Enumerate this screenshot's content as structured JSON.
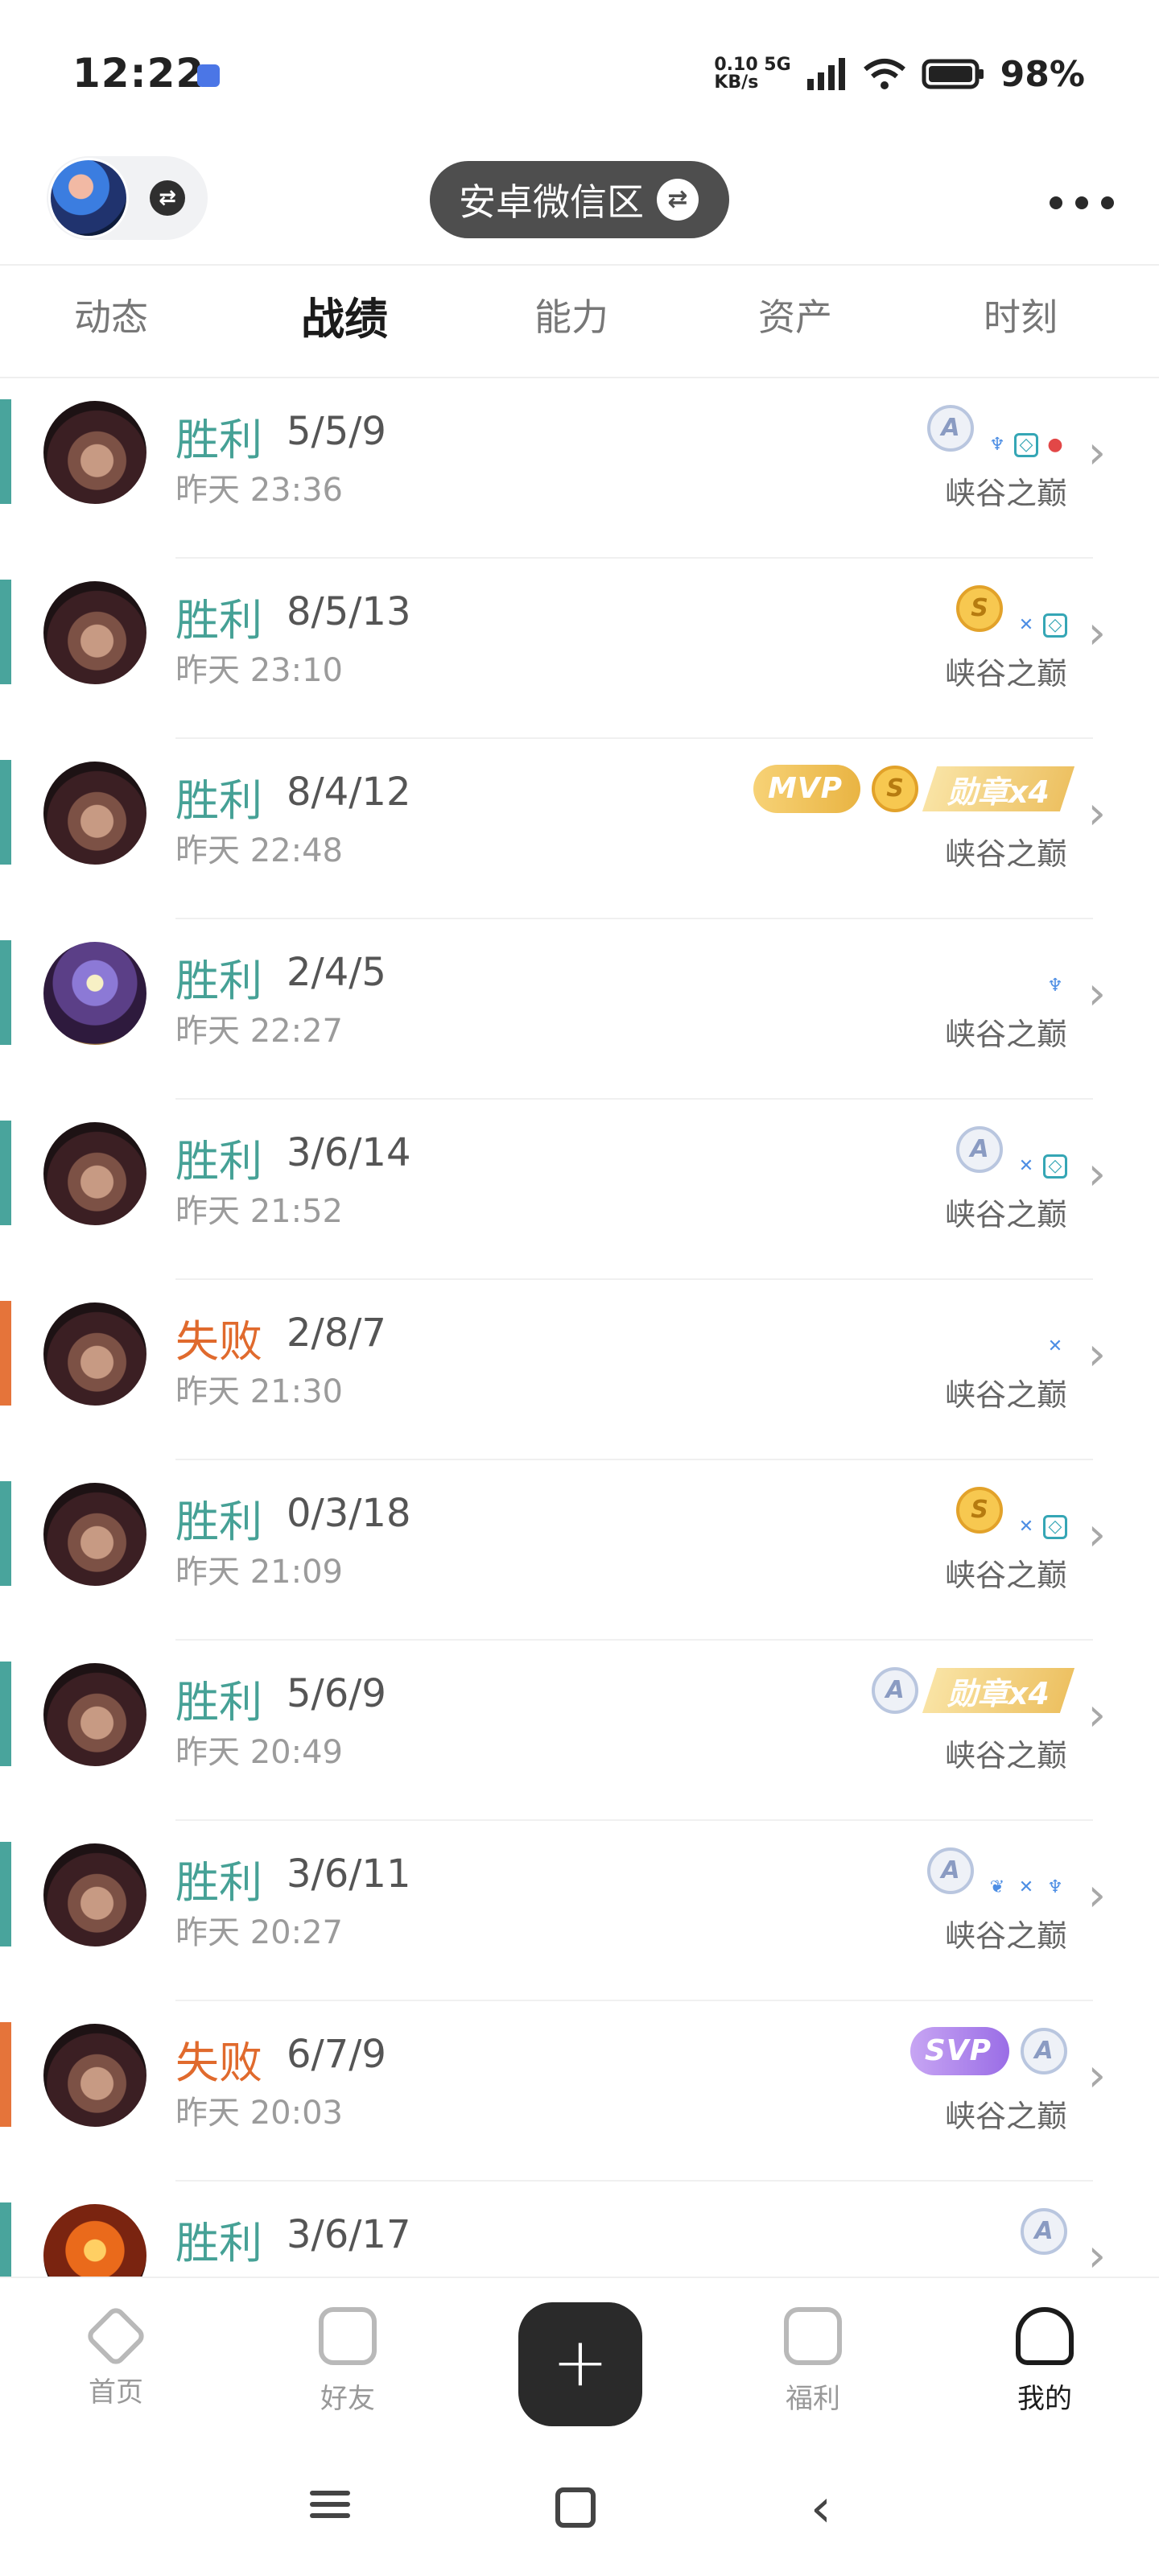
{
  "status_bar": {
    "time": "12:22",
    "net_speed_value": "0.10",
    "net_speed_unit": "KB/s",
    "network_type": "5G",
    "battery": "98%"
  },
  "header": {
    "server_name": "安卓微信区",
    "switch_symbol": "⇄"
  },
  "tabs": [
    {
      "label": "动态"
    },
    {
      "label": "战绩"
    },
    {
      "label": "能力"
    },
    {
      "label": "资产"
    },
    {
      "label": "时刻"
    }
  ],
  "matches": [
    {
      "result": "胜利",
      "kda": "5/5/9",
      "time": "昨天 23:36",
      "mode": "峡谷之巅",
      "grade": "A",
      "outcome": "win"
    },
    {
      "result": "胜利",
      "kda": "8/5/13",
      "time": "昨天 23:10",
      "mode": "峡谷之巅",
      "grade": "S",
      "outcome": "win"
    },
    {
      "result": "胜利",
      "kda": "8/4/12",
      "time": "昨天 22:48",
      "mode": "峡谷之巅",
      "grade": "S",
      "mvp_label": "MVP",
      "medal_label": "勋章x4",
      "outcome": "win"
    },
    {
      "result": "胜利",
      "kda": "2/4/5",
      "time": "昨天 22:27",
      "mode": "峡谷之巅",
      "outcome": "win"
    },
    {
      "result": "胜利",
      "kda": "3/6/14",
      "time": "昨天 21:52",
      "mode": "峡谷之巅",
      "grade": "A",
      "outcome": "win"
    },
    {
      "result": "失败",
      "kda": "2/8/7",
      "time": "昨天 21:30",
      "mode": "峡谷之巅",
      "outcome": "loss"
    },
    {
      "result": "胜利",
      "kda": "0/3/18",
      "time": "昨天 21:09",
      "mode": "峡谷之巅",
      "grade": "S",
      "outcome": "win"
    },
    {
      "result": "胜利",
      "kda": "5/6/9",
      "time": "昨天 20:49",
      "mode": "峡谷之巅",
      "grade": "A",
      "medal_label": "勋章x4",
      "outcome": "win"
    },
    {
      "result": "胜利",
      "kda": "3/6/11",
      "time": "昨天 20:27",
      "mode": "峡谷之巅",
      "grade": "A",
      "outcome": "win"
    },
    {
      "result": "失败",
      "kda": "6/7/9",
      "time": "昨天 20:03",
      "mode": "峡谷之巅",
      "grade": "A",
      "svp_label": "SVP",
      "outcome": "loss"
    },
    {
      "result": "胜利",
      "kda": "3/6/17",
      "grade": "A",
      "outcome": "win"
    }
  ],
  "bottom_nav": [
    {
      "label": "首页"
    },
    {
      "label": "好友"
    },
    {
      "label": "福利"
    },
    {
      "label": "我的"
    }
  ],
  "fab_symbol": "+",
  "colors": {
    "win": "#49a49c",
    "loss": "#e5743a",
    "active_text": "#1b1b1b"
  }
}
